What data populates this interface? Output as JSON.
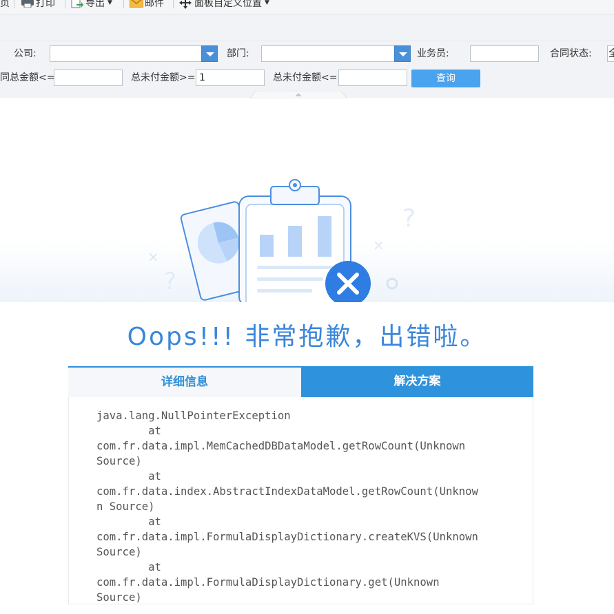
{
  "toolbar": {
    "partial_first": "页",
    "print_label": "打印",
    "export_label": "导出",
    "mail_label": "邮件",
    "panel_position_label": "面板自定义位置"
  },
  "params": {
    "company_label": "公司:",
    "company_value": "",
    "dept_label": "部门:",
    "dept_value": "",
    "salesman_label": "业务员:",
    "salesman_value": "",
    "contract_status_label": "合同状态:",
    "contract_status_value": "全",
    "contract_amount_label": "同总金额<=",
    "contract_amount_value": "",
    "unpaid_min_label": "总未付金额>=",
    "unpaid_min_value": "1",
    "unpaid_max_label": "总未付金额<=",
    "unpaid_max_value": "",
    "query_button": "查询"
  },
  "error": {
    "heading": "Oops!!! 非常抱歉，出错啦。",
    "tab_detail": "详细信息",
    "tab_solution": "解决方案",
    "stack_lines": [
      "java.lang.NullPointerException",
      "        at",
      "com.fr.data.impl.MemCachedDBDataModel.getRowCount(Unknown",
      "Source)",
      "        at",
      "com.fr.data.index.AbstractIndexDataModel.getRowCount(Unknow",
      "n Source)",
      "        at",
      "com.fr.data.impl.FormulaDisplayDictionary.createKVS(Unknown",
      "Source)",
      "        at",
      "com.fr.data.impl.FormulaDisplayDictionary.get(Unknown",
      "Source)"
    ]
  },
  "colors": {
    "accent": "#2e93dc",
    "query_button": "#4aa3ee",
    "heading": "#3b86db"
  },
  "icons": [
    "printer-icon",
    "export-icon",
    "mail-icon",
    "move-icon",
    "error-clipboard-illustration"
  ]
}
